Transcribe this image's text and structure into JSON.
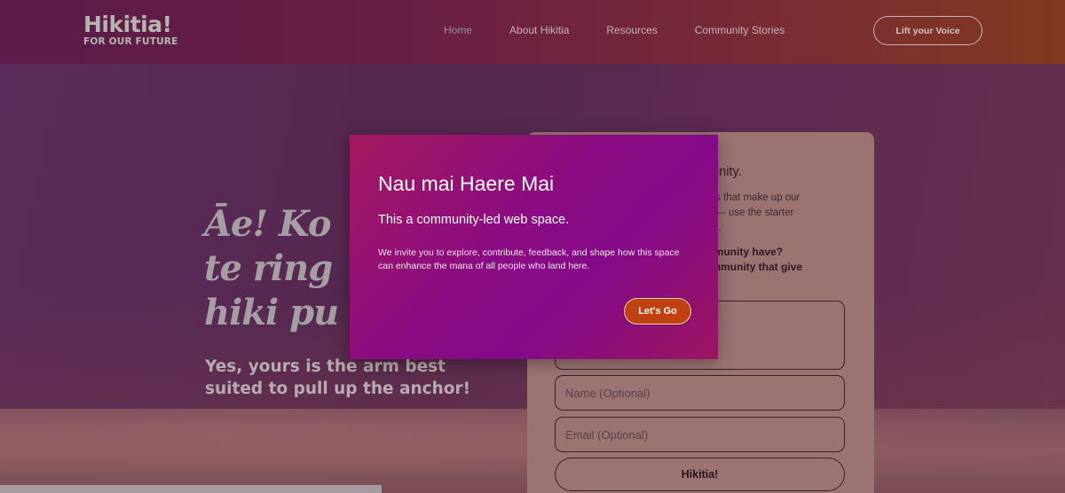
{
  "header": {
    "logo_name": "Hikitia!",
    "logo_tagline": "FOR OUR FUTURE",
    "nav": [
      "Home",
      "About Hikitia",
      "Resources",
      "Community Stories"
    ],
    "cta": "Lift your Voice"
  },
  "hero": {
    "title_line1": "Āe! Ko",
    "title_line2": "te ring",
    "title_line3": "hiki pu",
    "subtitle": "Yes, yours is the arm best suited to pull up the anchor!"
  },
  "form": {
    "heading": "nunity.",
    "intro_line1": "ties that make up our",
    "intro_line2": "ty — use the starter",
    "intro_line3": "ind.",
    "question_line1": "mmunity have?",
    "question_line2": "ommunity that give",
    "name_placeholder": "Name (Optional)",
    "email_placeholder": "Email (Optional)",
    "submit_label": "Hikitia!"
  },
  "modal": {
    "title": "Nau mai Haere Mai",
    "subtitle": "This a community-led web space.",
    "body": "We invite you to explore, contribute, feedback, and shape how this space can enhance the mana of all people who land here.",
    "button_label": "Let's Go"
  },
  "colors": {
    "modal_gradient_start": "#a3195e",
    "modal_gradient_mid": "#850a88",
    "button_orange": "#c0410f"
  }
}
